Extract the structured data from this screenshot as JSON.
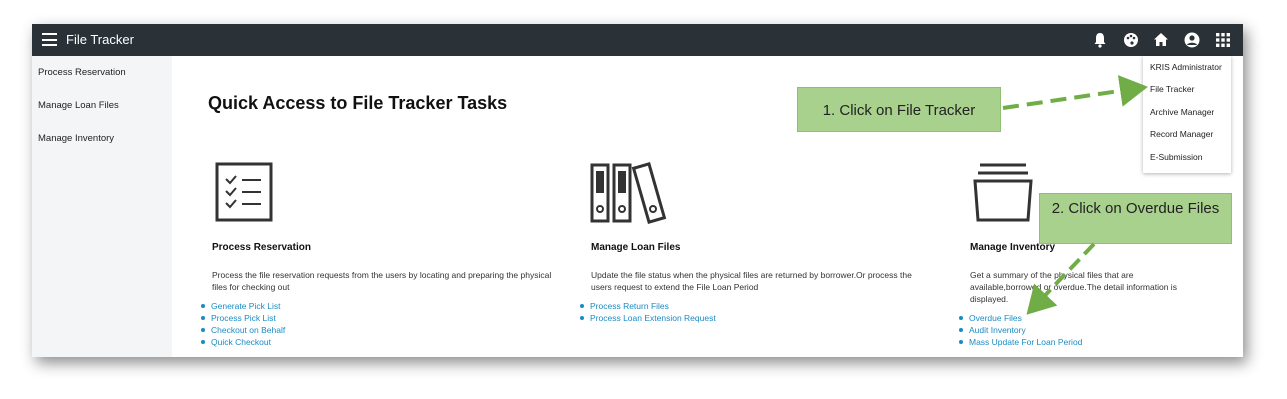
{
  "app": {
    "title": "File Tracker"
  },
  "header_icons": [
    "bell-icon",
    "palette-icon",
    "home-icon",
    "user-circle-icon",
    "apps-grid-icon"
  ],
  "sidebar": {
    "items": [
      {
        "label": "Process Reservation"
      },
      {
        "label": "Manage Loan Files"
      },
      {
        "label": "Manage Inventory"
      }
    ]
  },
  "main": {
    "title": "Quick Access to File Tracker Tasks",
    "cards": [
      {
        "icon": "checklist-icon",
        "title": "Process Reservation",
        "description": "Process the file reservation requests from the users by locating and preparing the physical files for checking out",
        "links": [
          "Generate Pick List",
          "Process Pick List",
          "Checkout on Behalf",
          "Quick Checkout"
        ]
      },
      {
        "icon": "binders-icon",
        "title": "Manage Loan Files",
        "description": "Update the file status when the physical files are returned by borrower.Or process the users request to extend the File Loan Period",
        "links": [
          "Process Return Files",
          "Process Loan Extension Request"
        ]
      },
      {
        "icon": "inventory-tray-icon",
        "title": "Manage Inventory",
        "description": "Get a summary of the physical files that are available,borrowed or overdue.The detail information is displayed.",
        "links": [
          "Overdue Files",
          "Audit Inventory",
          "Mass Update For Loan Period"
        ]
      }
    ]
  },
  "apps_menu": {
    "items": [
      {
        "label": "KRIS Administrator"
      },
      {
        "label": "File Tracker"
      },
      {
        "label": "Archive Manager"
      },
      {
        "label": "Record Manager"
      },
      {
        "label": "E-Submission"
      }
    ]
  },
  "callouts": {
    "step1": "1. Click on File Tracker",
    "step2": "2. Click on Overdue Files"
  },
  "colors": {
    "topbar": "#2b3237",
    "link": "#1a8bc4",
    "callout": "#a9d18e",
    "arrow": "#70ad47"
  }
}
